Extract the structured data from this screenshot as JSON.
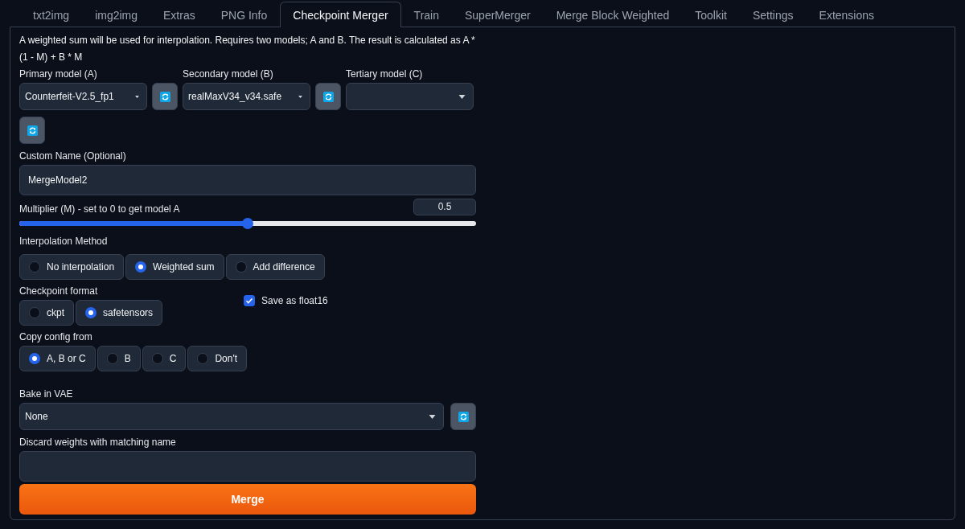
{
  "tabs": [
    {
      "label": "txt2img",
      "selected": false
    },
    {
      "label": "img2img",
      "selected": false
    },
    {
      "label": "Extras",
      "selected": false
    },
    {
      "label": "PNG Info",
      "selected": false
    },
    {
      "label": "Checkpoint Merger",
      "selected": true
    },
    {
      "label": "Train",
      "selected": false
    },
    {
      "label": "SuperMerger",
      "selected": false
    },
    {
      "label": "Merge Block Weighted",
      "selected": false
    },
    {
      "label": "Toolkit",
      "selected": false
    },
    {
      "label": "Settings",
      "selected": false
    },
    {
      "label": "Extensions",
      "selected": false
    }
  ],
  "description": "A weighted sum will be used for interpolation. Requires two models; A and B. The result is calculated as A * (1 - M) + B * M",
  "models": [
    {
      "label": "Primary model (A)",
      "value": "Counterfeit-V2.5_fp1"
    },
    {
      "label": "Secondary model (B)",
      "value": "realMaxV34_v34.safe"
    },
    {
      "label": "Tertiary model (C)"
    }
  ],
  "custom_name": {
    "label": "Custom Name (Optional)",
    "value": "MergeModel2"
  },
  "multiplier": {
    "label": "Multiplier (M) - set to 0 to get model A",
    "reading": "0.5",
    "level": 0.5
  },
  "interpolation": {
    "label": "Interpolation Method",
    "options": [
      {
        "label": "No interpolation",
        "selected": false
      },
      {
        "label": "Weighted sum",
        "selected": true
      },
      {
        "label": "Add difference",
        "selected": false
      }
    ]
  },
  "checkpoint_format": {
    "label": "Checkpoint format",
    "options": [
      {
        "label": "ckpt",
        "selected": false
      },
      {
        "label": "safetensors",
        "selected": true
      }
    ]
  },
  "save_float16": {
    "label": "Save as float16",
    "checked": true
  },
  "copy_config": {
    "label": "Copy config from",
    "options": [
      {
        "label": "A, B or C",
        "selected": true
      },
      {
        "label": "B",
        "selected": false
      },
      {
        "label": "C",
        "selected": false
      },
      {
        "label": "Don't",
        "selected": false
      }
    ]
  },
  "bake_vae": {
    "label": "Bake in VAE",
    "value": "None"
  },
  "discard_weights": {
    "label": "Discard weights with matching name"
  },
  "merge_button": "Merge"
}
